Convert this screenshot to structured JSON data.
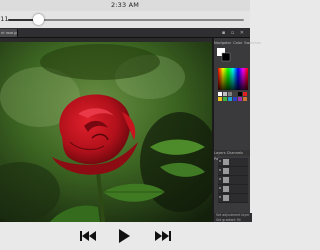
{
  "status_bar": {
    "time": "2:33 AM"
  },
  "player": {
    "elapsed": ":11",
    "progress_fraction": 0.13
  },
  "editor": {
    "document_tab": "nt rose.jpg @",
    "panel_tabs_top": [
      "Navigator",
      "Color",
      "Swatches"
    ],
    "panel_tabs_layers": [
      "Layers",
      "Channels",
      "Paths"
    ],
    "panel_footer": [
      "Set adjustment layer",
      "Set adjustment layer",
      "Set gradient fill"
    ]
  },
  "transport": {
    "previous_icon": "previous-track-icon",
    "play_icon": "play-icon",
    "next_icon": "next-track-icon"
  },
  "colors": {
    "rose": "#b0101a",
    "foliage": "#2f5a1c"
  }
}
